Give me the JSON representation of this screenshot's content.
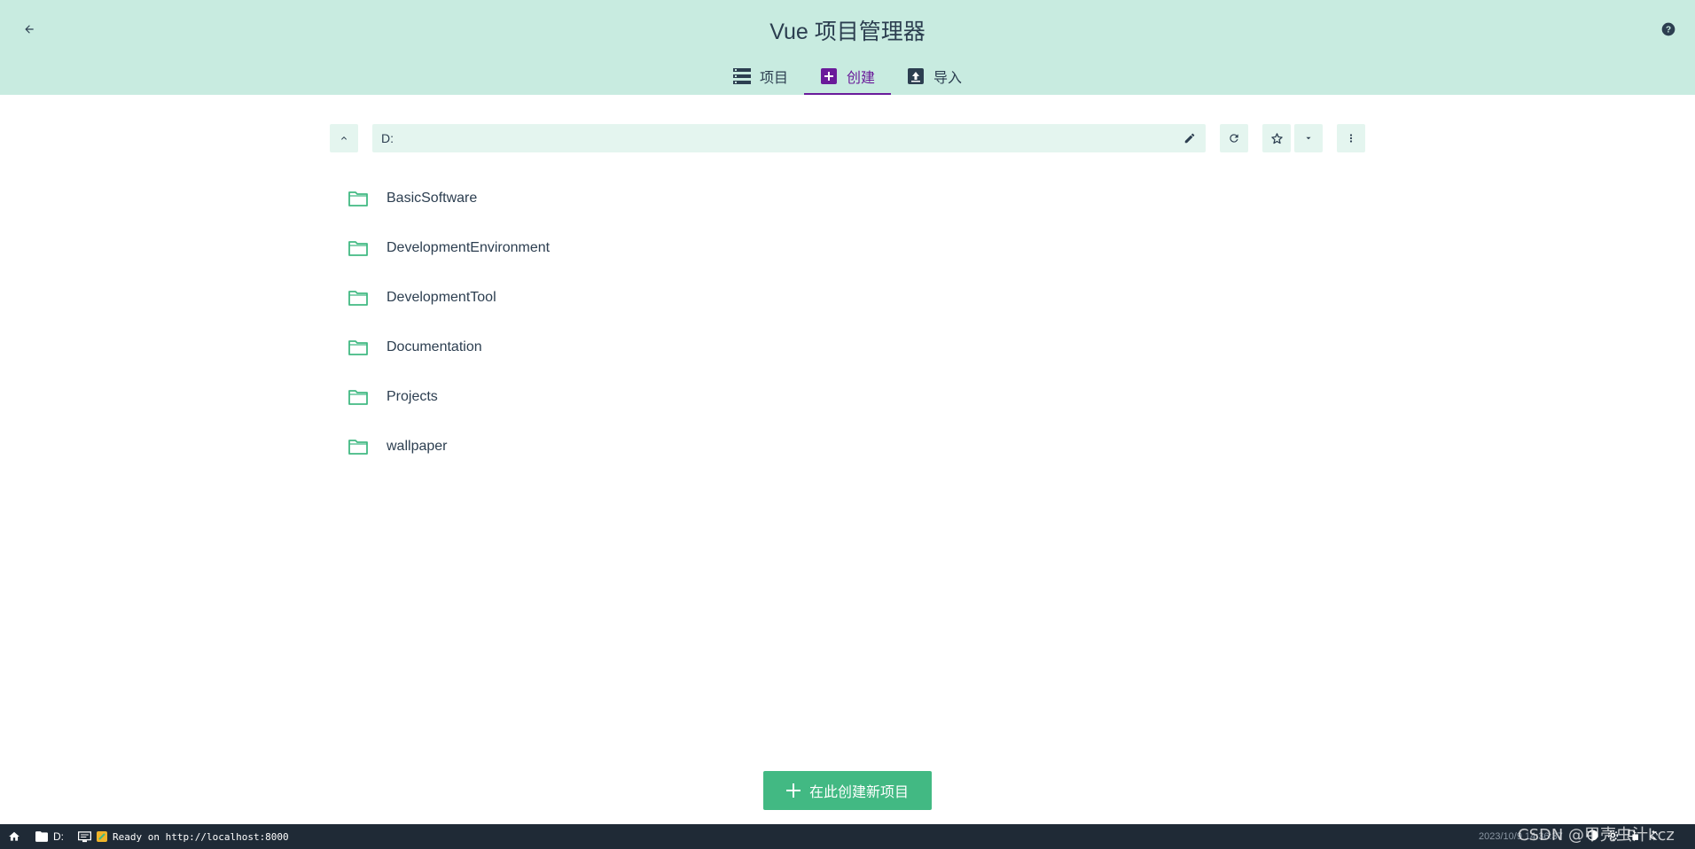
{
  "app": {
    "title": "Vue 项目管理器"
  },
  "tabs": [
    {
      "label": "项目",
      "icon": "list-icon",
      "active": false
    },
    {
      "label": "创建",
      "icon": "add-box-icon",
      "active": true
    },
    {
      "label": "导入",
      "icon": "upload-icon",
      "active": false
    }
  ],
  "toolbar": {
    "path_value": "D:"
  },
  "folders": [
    {
      "name": "BasicSoftware"
    },
    {
      "name": "DevelopmentEnvironment"
    },
    {
      "name": "DevelopmentTool"
    },
    {
      "name": "Documentation"
    },
    {
      "name": "Projects"
    },
    {
      "name": "wallpaper"
    }
  ],
  "create_button": {
    "label": "在此创建新项目"
  },
  "status": {
    "cwd": "D:",
    "log": "Ready on http://localhost:8000",
    "time": "2023/10/9 14:36:37"
  },
  "watermark": "CSDN @甲壳虫汁kcz",
  "colors": {
    "header_bg": "#c8ebe0",
    "accent": "#42b983",
    "active_tab": "#6a1b9a",
    "statusbar_bg": "#1f2a36"
  }
}
